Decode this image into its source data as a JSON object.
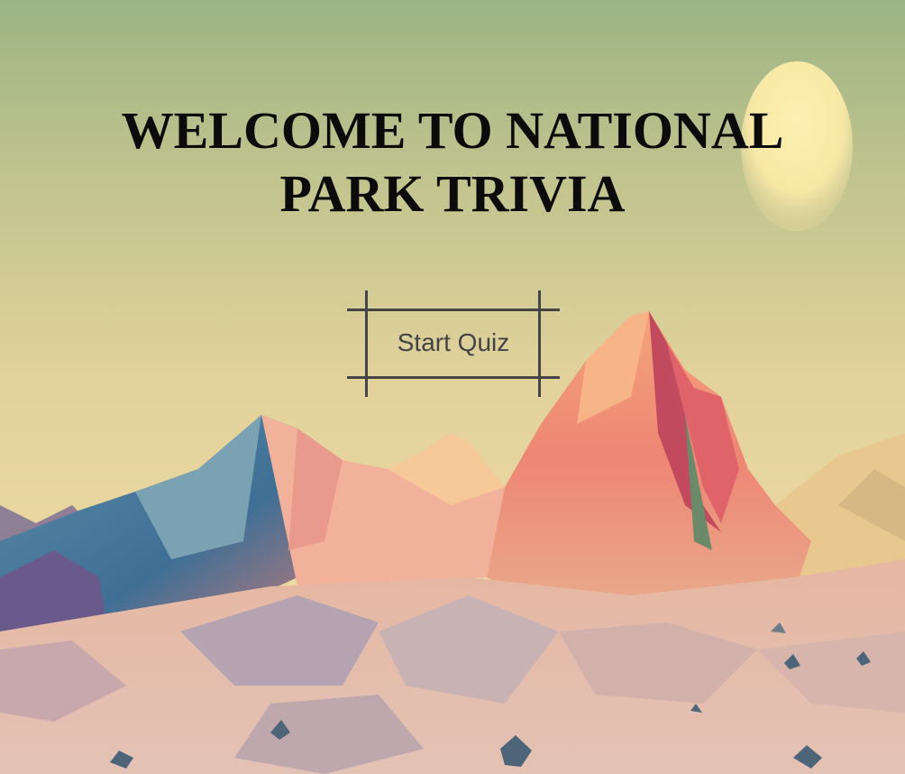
{
  "title": {
    "line1": "WELCOME TO NATIONAL",
    "line2": "PARK TRIVIA"
  },
  "start_button": {
    "label": "Start Quiz"
  },
  "colors": {
    "sky_top": "#9db385",
    "sky_bottom": "#ead9a0",
    "sun": "#fbeba6",
    "title": "#0b0b0b",
    "button_frame": "#454545"
  },
  "background": {
    "icons": [
      "sun-icon",
      "mountain-range",
      "rocks"
    ]
  }
}
